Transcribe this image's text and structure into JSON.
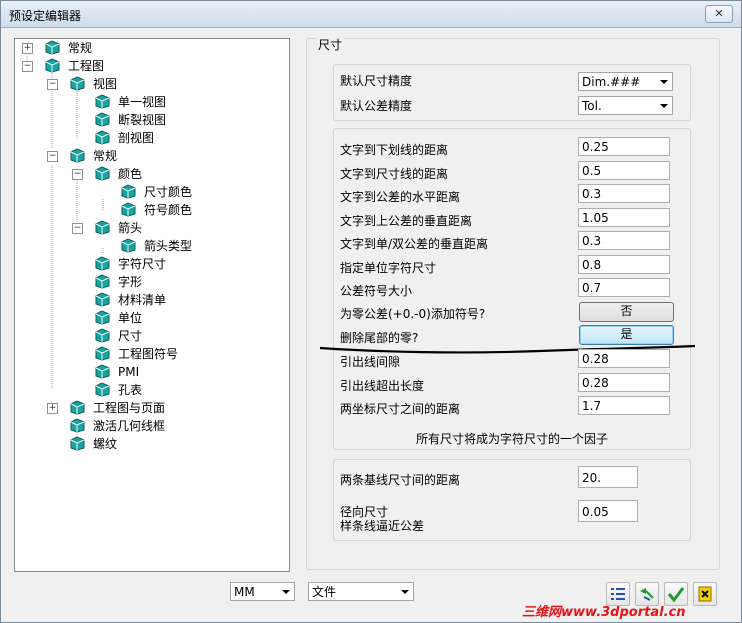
{
  "window": {
    "title": "预设定编辑器",
    "close_glyph": "✕"
  },
  "tree": {
    "nodes": [
      {
        "label": "常规",
        "expander": "+"
      },
      {
        "label": "工程图",
        "expander": "−"
      },
      {
        "label": "视图",
        "expander": "−"
      },
      {
        "label": "单一视图"
      },
      {
        "label": "断裂视图"
      },
      {
        "label": "剖视图"
      },
      {
        "label": "常规",
        "expander": "−"
      },
      {
        "label": "颜色",
        "expander": "−"
      },
      {
        "label": "尺寸颜色"
      },
      {
        "label": "符号颜色"
      },
      {
        "label": "箭头",
        "expander": "−"
      },
      {
        "label": "箭头类型"
      },
      {
        "label": "字符尺寸"
      },
      {
        "label": "字形"
      },
      {
        "label": "材料清单"
      },
      {
        "label": "单位"
      },
      {
        "label": "尺寸"
      },
      {
        "label": "工程图符号"
      },
      {
        "label": "PMI"
      },
      {
        "label": "孔表"
      },
      {
        "label": "工程图与页面",
        "expander": "+"
      },
      {
        "label": "激活几何线框"
      },
      {
        "label": "螺纹"
      }
    ]
  },
  "panel": {
    "section_title": "尺寸",
    "precision": {
      "label": "默认尺寸精度",
      "value": "Dim.###"
    },
    "tolerance": {
      "label": "默认公差精度",
      "value": "Tol."
    },
    "fields": [
      {
        "label": "文字到下划线的距离",
        "value": "0.25"
      },
      {
        "label": "文字到尺寸线的距离",
        "value": "0.5"
      },
      {
        "label": "文字到公差的水平距离",
        "value": "0.3"
      },
      {
        "label": "文字到上公差的垂直距离",
        "value": "1.05"
      },
      {
        "label": "文字到单/双公差的垂直距离",
        "value": "0.3"
      },
      {
        "label": "指定单位字符尺寸",
        "value": "0.8"
      },
      {
        "label": "公差符号大小",
        "value": "0.7"
      }
    ],
    "zero_tol": {
      "label": "为零公差(+0.-0)添加符号?",
      "button": "否"
    },
    "trailing_zero": {
      "label": "删除尾部的零?",
      "button": "是"
    },
    "fields2": [
      {
        "label": "引出线间隙",
        "value": "0.28"
      },
      {
        "label": "引出线超出长度",
        "value": "0.28"
      },
      {
        "label": "两坐标尺寸之间的距离",
        "value": "1.7"
      }
    ],
    "factor_note": "所有尺寸将成为字符尺寸的一个因子",
    "baseline": {
      "label": "两条基线尺寸间的距离",
      "value": "20."
    },
    "radial": {
      "label1": "径向尺寸",
      "label2": "样条线逼近公差",
      "value": "0.05"
    }
  },
  "bottom": {
    "units": "MM",
    "file": "文件"
  },
  "watermark": "三维网www.3dportal.cn"
}
